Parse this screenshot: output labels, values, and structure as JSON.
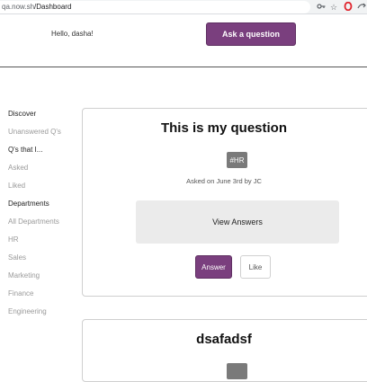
{
  "browser": {
    "url_host": "qa.now.sh",
    "url_path": "/Dashboard",
    "icons": [
      "key-icon",
      "star-icon",
      "opera-icon",
      "extension-icon"
    ]
  },
  "header": {
    "greeting": "Hello, dasha!",
    "ask_button": "Ask a question"
  },
  "sidebar": {
    "discover": "Discover",
    "unanswered": "Unanswered Q's",
    "qs_that_i": "Q's that I...",
    "asked": "Asked",
    "liked": "Liked",
    "departments": "Departments",
    "all_departments": "All Departments",
    "hr": "HR",
    "sales": "Sales",
    "marketing": "Marketing",
    "finance": "Finance",
    "engineering": "Engineering"
  },
  "questions": [
    {
      "title": "This is my question",
      "tag": "#HR",
      "meta": "Asked on June 3rd by JC",
      "view_answers": "View Answers",
      "answer": "Answer",
      "like": "Like"
    },
    {
      "title": "dsafadsf"
    }
  ],
  "colors": {
    "accent": "#7a3f7e",
    "tag_bg": "#7a7a7a"
  }
}
